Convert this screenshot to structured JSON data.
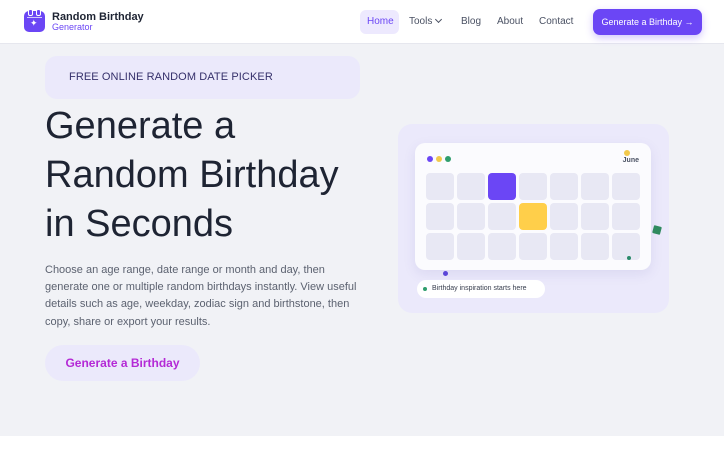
{
  "brand": {
    "name": "Random Birthday",
    "subtitle": "Generator",
    "logo_icon": "calendar-sparkle-icon"
  },
  "nav": {
    "items": [
      {
        "label": "Home",
        "active": true
      },
      {
        "label": "Tools",
        "has_dropdown": true,
        "dropdown_icon": "chevron-down-icon"
      },
      {
        "label": "Blog"
      },
      {
        "label": "About"
      },
      {
        "label": "Contact"
      }
    ],
    "cta_label": "Generate a Birthday →"
  },
  "hero": {
    "badge": "FREE ONLINE RANDOM DATE PICKER",
    "title_lines": [
      "Generate a",
      "Random Birthday",
      "in Seconds"
    ],
    "description": "Choose an age range, date range or month and day, then generate one or multiple random birthdays instantly. View useful details such as age, weekday, zodiac sign and birthstone, then copy, share or export your results.",
    "cta_label": "Generate a Birthday"
  },
  "illustration": {
    "month": "June",
    "caption": "Birthday inspiration starts here",
    "grid_rows": 3,
    "grid_cols": 7,
    "highlighted_cells": [
      {
        "row": 0,
        "col": 2,
        "color": "#6b46f5"
      },
      {
        "row": 1,
        "col": 3,
        "color": "#ffcf4a"
      }
    ]
  },
  "colors": {
    "accent": "#6b46f5",
    "cta_text": "#b42ad6",
    "badge_bg": "#ebe9fb",
    "highlight_yellow": "#ffcf4a",
    "text_dark": "#1e2433"
  }
}
